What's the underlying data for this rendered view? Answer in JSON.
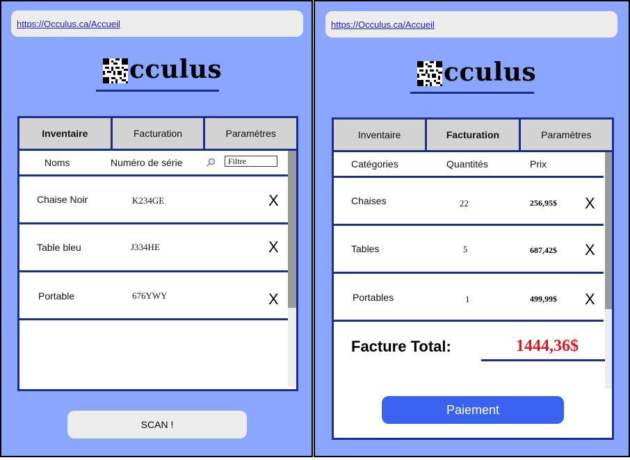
{
  "url": "https://Occulus.ca/Accueil",
  "logo_text": "cculus",
  "tabs": [
    "Inventaire",
    "Facturation",
    "Paramètres"
  ],
  "inventory": {
    "headers": {
      "names": "Noms",
      "serial": "Numéro de série"
    },
    "filter_value": "Filtre",
    "rows": [
      {
        "name": "Chaise Noir",
        "serial": "K234GE",
        "delete": "X"
      },
      {
        "name": "Table bleu",
        "serial": "J334HE",
        "delete": "X"
      },
      {
        "name": "Portable",
        "serial": "676YWY",
        "delete": "X"
      }
    ],
    "scan_label": "SCAN !"
  },
  "billing": {
    "headers": {
      "categories": "Catégories",
      "quantities": "Quantités",
      "price": "Prix"
    },
    "rows": [
      {
        "category": "Chaises",
        "qty": "22",
        "price": "256,95$",
        "delete": "X"
      },
      {
        "category": "Tables",
        "qty": "5",
        "price": "687,42$",
        "delete": "X"
      },
      {
        "category": "Portables",
        "qty": "1",
        "price": "499,99$",
        "delete": "X"
      }
    ],
    "total_label": "Facture Total:",
    "total_value": "1444,36$",
    "pay_label": "Paiement"
  },
  "colors": {
    "background": "#8ba6ff",
    "accent_border": "#1b2f8a",
    "total_red": "#e8141c",
    "pay_button": "#3a62f0"
  },
  "icons": [
    "qr-logo-icon",
    "magnifier-icon"
  ]
}
